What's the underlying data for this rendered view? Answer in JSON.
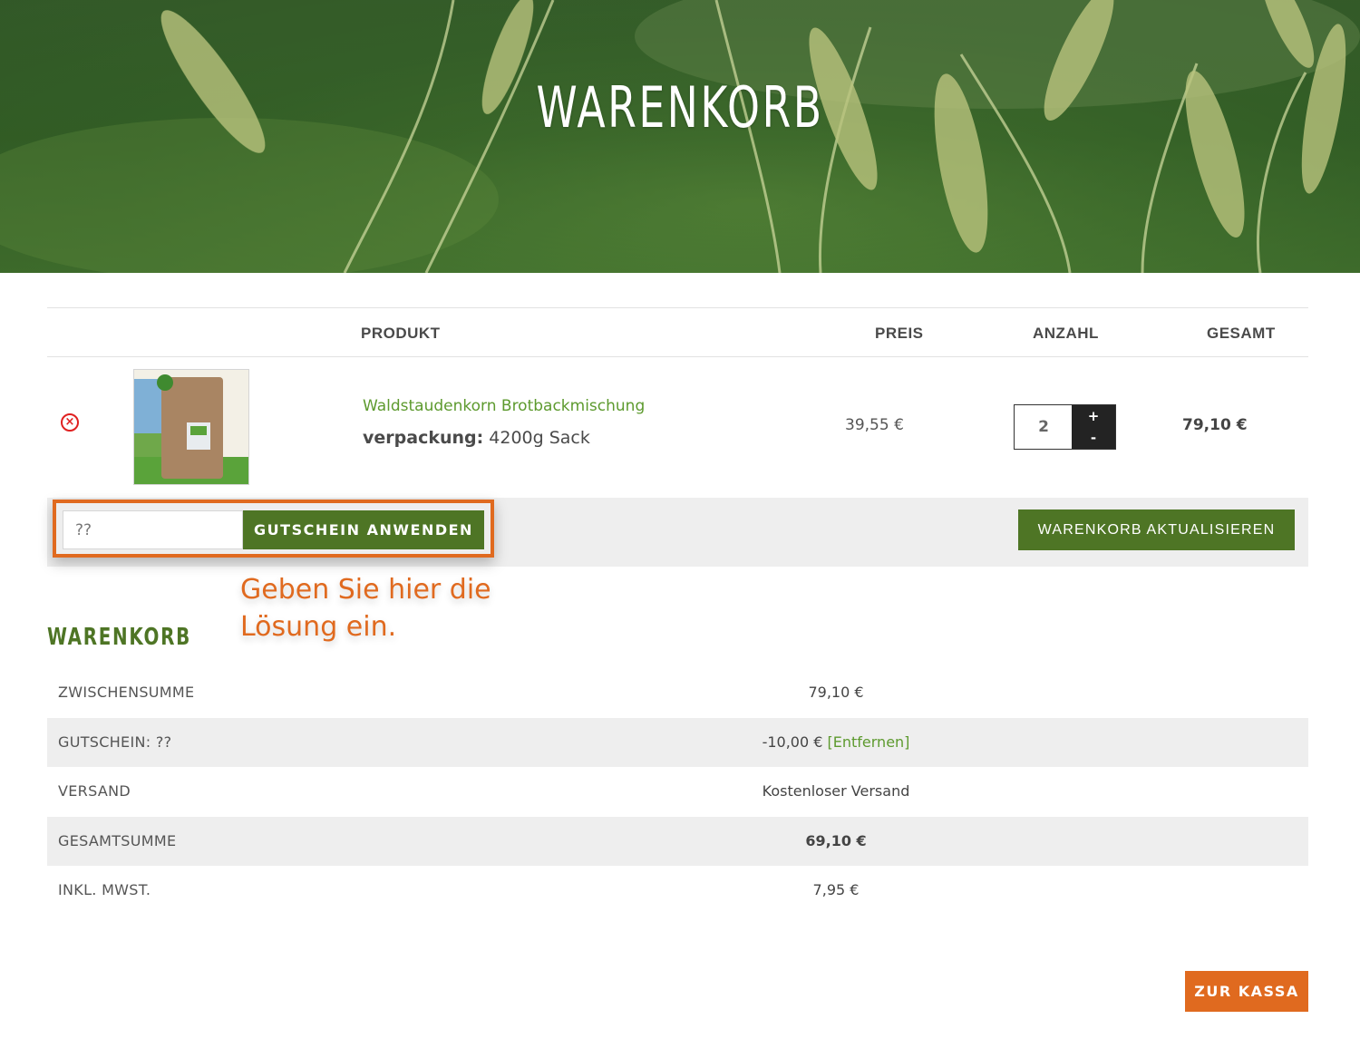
{
  "page": {
    "title": "WARENKORB"
  },
  "table": {
    "headers": {
      "product": "PRODUKT",
      "price": "PREIS",
      "quantity": "ANZAHL",
      "total": "GESAMT"
    },
    "items": [
      {
        "remove_icon": "remove-circle-icon",
        "product_name": "Waldstaudenkorn Brotbackmischung",
        "variation_label": "verpackung:",
        "variation_value": "4200g Sack",
        "price": "39,55 €",
        "quantity": "2",
        "plus": "+",
        "minus": "-",
        "total": "79,10 €"
      }
    ]
  },
  "coupon": {
    "value": "??",
    "apply_label": "GUTSCHEIN ANWENDEN",
    "hint": "Geben Sie hier die Lösung ein."
  },
  "update_label": "WARENKORB AKTUALISIEREN",
  "totals": {
    "title": "WARENKORB",
    "rows": [
      {
        "label": "ZWISCHENSUMME",
        "value": "79,10 €"
      },
      {
        "label": "GUTSCHEIN: ??",
        "value": "-10,00 €",
        "link": "[Entfernen]"
      },
      {
        "label": "VERSAND",
        "value": "Kostenloser Versand"
      },
      {
        "label": "GESAMTSUMME",
        "value": "69,10 €"
      },
      {
        "label": "INKL. MWST.",
        "value": "7,95 €"
      }
    ]
  },
  "checkout_label": "ZUR KASSA",
  "colors": {
    "accent_green": "#4e7525",
    "link_green": "#5d9a2e",
    "orange": "#e06a1f",
    "remove_red": "#e02020"
  }
}
